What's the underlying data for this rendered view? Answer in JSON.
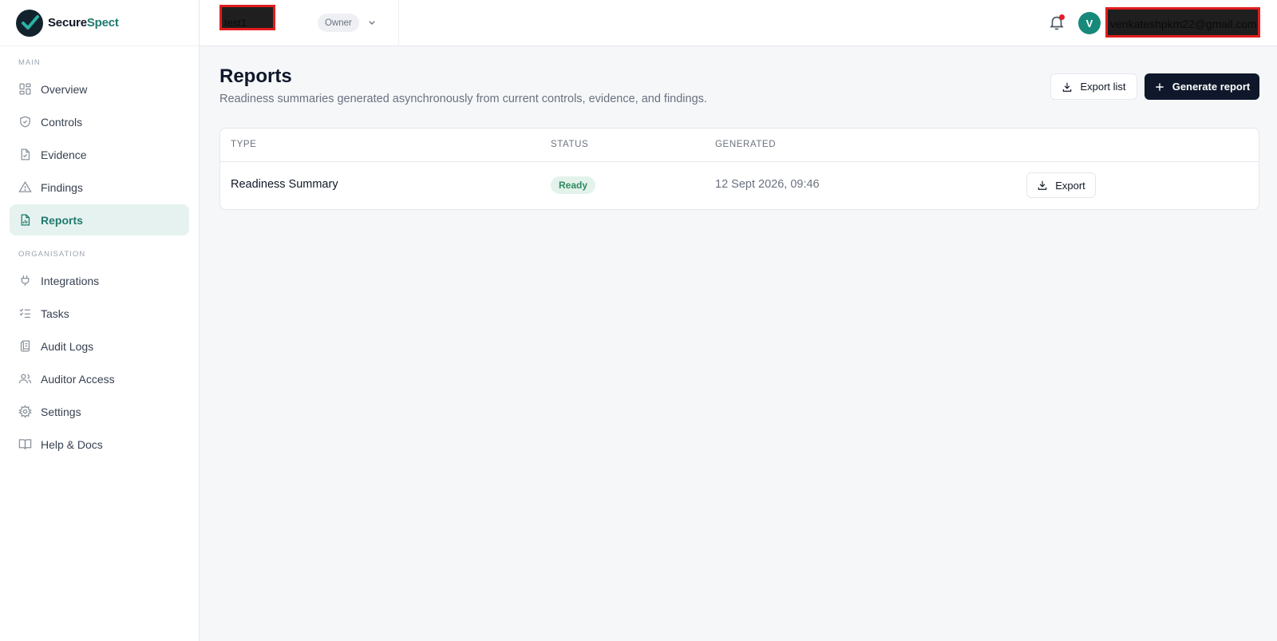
{
  "app": {
    "brand_prefix": "Secure",
    "brand_suffix": "Spect"
  },
  "topbar": {
    "org_name": "test1",
    "role": "Owner",
    "avatar_initial": "V",
    "user_email": "venkateshpkm22@gmail.com"
  },
  "sidebar": {
    "main_label": "MAIN",
    "org_label": "ORGANISATION",
    "main_items": [
      {
        "label": "Overview",
        "icon": "grid-icon"
      },
      {
        "label": "Controls",
        "icon": "shield-check-icon"
      },
      {
        "label": "Evidence",
        "icon": "file-icon"
      },
      {
        "label": "Findings",
        "icon": "warning-triangle-icon"
      },
      {
        "label": "Reports",
        "icon": "report-chart-icon",
        "active": true
      }
    ],
    "org_items": [
      {
        "label": "Integrations",
        "icon": "plug-icon"
      },
      {
        "label": "Tasks",
        "icon": "checklist-icon"
      },
      {
        "label": "Audit Logs",
        "icon": "scroll-icon"
      },
      {
        "label": "Auditor Access",
        "icon": "users-icon"
      },
      {
        "label": "Settings",
        "icon": "gear-icon"
      },
      {
        "label": "Help & Docs",
        "icon": "book-icon"
      }
    ]
  },
  "page": {
    "title": "Reports",
    "subtitle": "Readiness summaries generated asynchronously from current controls, evidence, and findings.",
    "export_list_label": "Export list",
    "generate_label": "Generate report"
  },
  "table": {
    "columns": [
      "TYPE",
      "STATUS",
      "GENERATED"
    ],
    "rows": [
      {
        "type": "Readiness Summary",
        "status": "Ready",
        "generated": "12 Sept 2026, 09:46",
        "action": "Export"
      }
    ]
  },
  "colors": {
    "accent": "#1f7a6e",
    "primary_button": "#0f172a",
    "avatar": "#16897a",
    "badge_bg": "#e3f3eb",
    "badge_text": "#2f8a5f"
  }
}
